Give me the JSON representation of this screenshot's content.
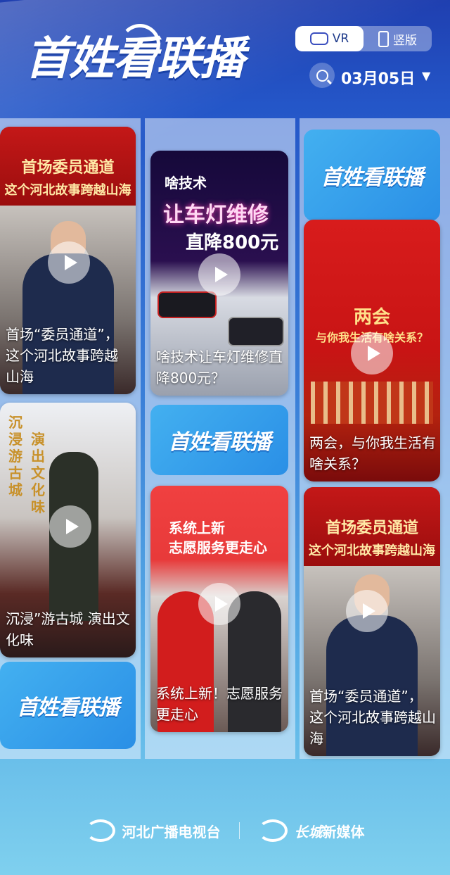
{
  "header": {
    "logo_text": "首姓看联播",
    "mode_vr_label": "VR",
    "mode_portrait_label": "竖版",
    "date": "03月05日",
    "date_caret": "▼"
  },
  "cards": {
    "c1": {
      "banner_line1": "首场委员通道",
      "banner_line2": "这个河北故事跨越山海",
      "caption": "首场“委员通道”，这个河北故事跨越山海"
    },
    "c2": {
      "poster_line1": "啥技术",
      "poster_line2": "让车灯维修",
      "poster_line3": "直降800元",
      "caption": "啥技术让车灯维修直降800元？"
    },
    "c3": {
      "poster_line1": "两会",
      "poster_line2": "与你我生活有啥关系？",
      "caption": "两会，与你我生活有啥关系？"
    },
    "c4": {
      "poster_col1": "沉浸游古城",
      "poster_col2": "演出文化味",
      "caption": "沉浸”游古城 演出文化味"
    },
    "c5": {
      "poster_line1": "系统上新",
      "poster_line2": "志愿服务更走心",
      "caption": "系统上新！志愿服务更走心"
    },
    "c6": {
      "banner_line1": "首场委员通道",
      "banner_line2": "这个河北故事跨越山海",
      "caption": "首场“委员通道”，这个河北故事跨越山海"
    }
  },
  "brand_tile_text": "首姓看联播",
  "footer": {
    "org1": "河北广播电视台",
    "org2_script": "长城",
    "org2_rest": "新媒体"
  },
  "colors": {
    "banner_red": "#c41818",
    "accent_blue": "#2a8fe6",
    "gold": "#e8b24a"
  }
}
